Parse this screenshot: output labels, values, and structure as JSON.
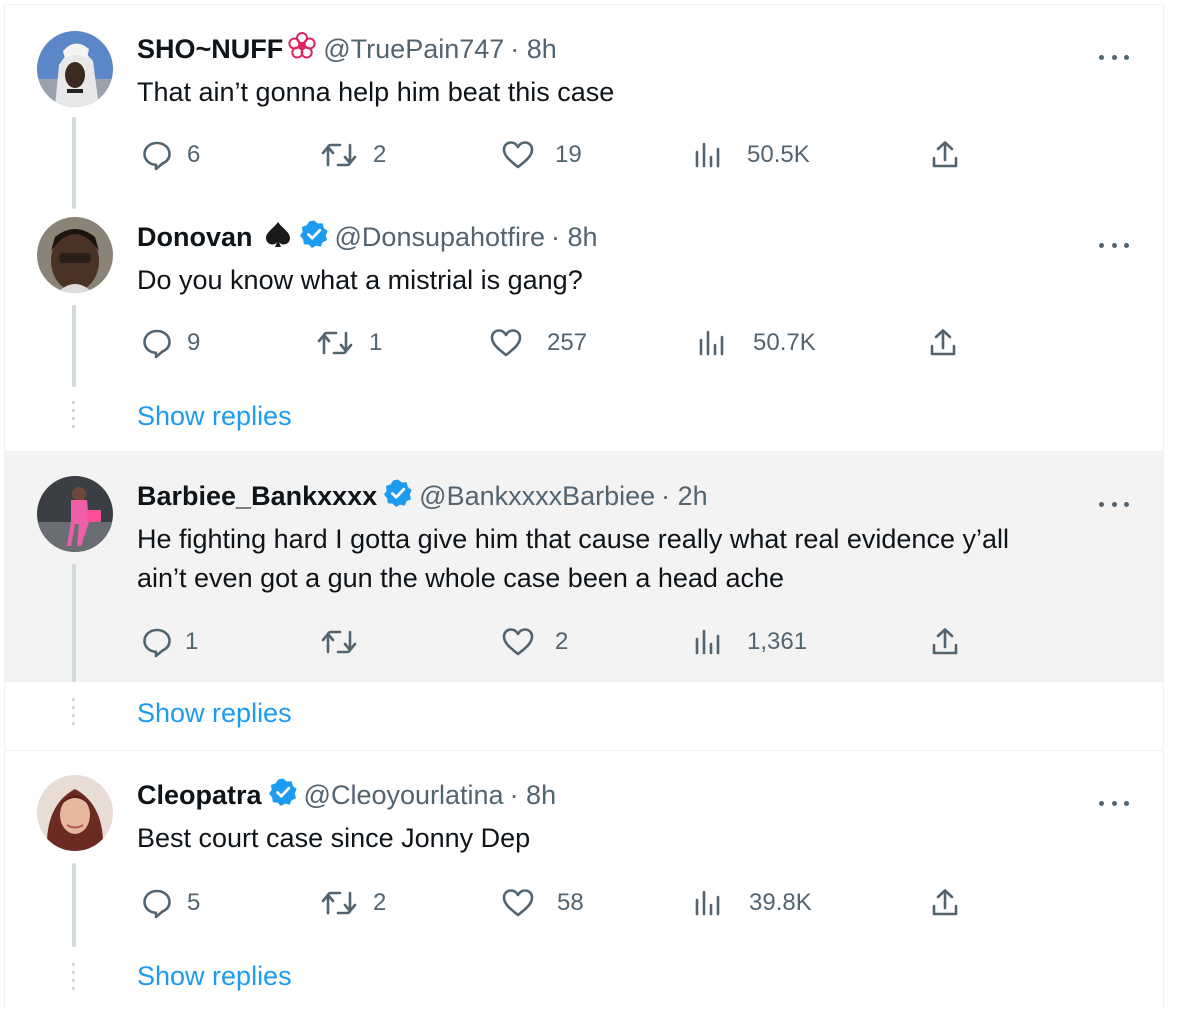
{
  "tweets": [
    {
      "name": "SHO~NUFF",
      "handle": "@TruePain747",
      "time": "· 8h",
      "text": "That ain’t gonna help him beat this case",
      "replies": "6",
      "retweets": "2",
      "likes": "19",
      "views": "50.5K",
      "badge": "red-flower-emoji",
      "verified": false
    },
    {
      "name": "Donovan",
      "handle": "@Donsupahotfire",
      "time": "· 8h",
      "text": "Do you know what a mistrial is gang?",
      "replies": "9",
      "retweets": "1",
      "likes": "257",
      "views": "50.7K",
      "badge": "spade-emoji",
      "verified": true,
      "show_replies": "Show replies"
    },
    {
      "name": "Barbiee_Bankxxxx",
      "handle": "@BankxxxxBarbiee",
      "time": "· 2h",
      "text_line1": "He fighting hard I gotta give him that cause really what real evidence y’all",
      "text_line2": "ain’t even got a gun the whole case been a head ache",
      "replies": "1",
      "retweets": "",
      "likes": "2",
      "views": "1,361",
      "verified": true,
      "show_replies": "Show replies"
    },
    {
      "name": "Cleopatra",
      "handle": "@Cleoyourlatina",
      "time": "· 8h",
      "text": "Best court case since Jonny Dep",
      "replies": "5",
      "retweets": "2",
      "likes": "58",
      "views": "39.8K",
      "verified": true,
      "show_replies": "Show replies"
    }
  ],
  "colors": {
    "accent": "#1d9bf0",
    "text": "#0f1419",
    "muted": "#536471",
    "highlight_bg": "#f3f3f3",
    "thread_line": "#cfd9de"
  },
  "icons": [
    "reply-icon",
    "retweet-icon",
    "like-icon",
    "views-icon",
    "share-icon",
    "more-icon",
    "verified-badge-icon"
  ]
}
